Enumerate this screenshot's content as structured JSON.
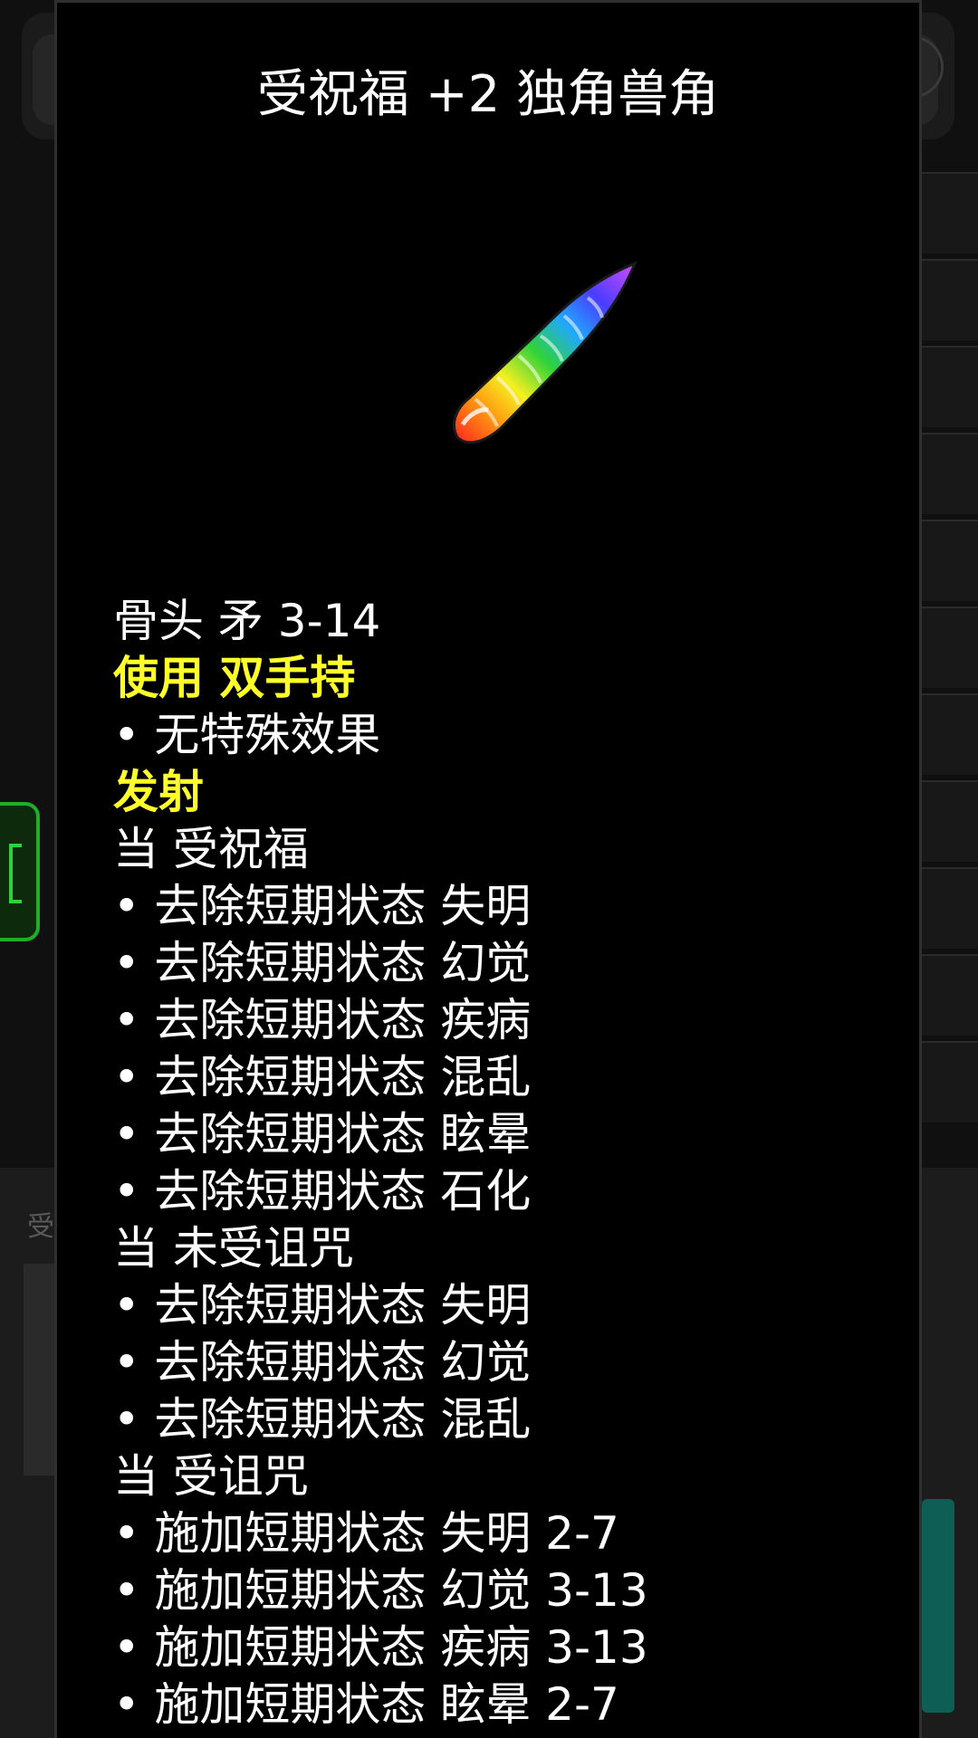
{
  "background": {
    "partial_label": "受"
  },
  "item": {
    "title": "受祝福 +2 独角兽角",
    "image_icon": "unicorn-horn-icon",
    "lines": [
      {
        "text": "骨头 矛 3-14",
        "style": "white"
      },
      {
        "text": "使用 双手持",
        "style": "yellow"
      },
      {
        "text": "无特殊效果",
        "style": "bullet"
      },
      {
        "text": "发射",
        "style": "yellow"
      },
      {
        "text": "当 受祝福",
        "style": "white"
      },
      {
        "text": "去除短期状态 失明",
        "style": "bullet"
      },
      {
        "text": "去除短期状态 幻觉",
        "style": "bullet"
      },
      {
        "text": "去除短期状态 疾病",
        "style": "bullet"
      },
      {
        "text": "去除短期状态 混乱",
        "style": "bullet"
      },
      {
        "text": "去除短期状态 眩晕",
        "style": "bullet"
      },
      {
        "text": "去除短期状态 石化",
        "style": "bullet"
      },
      {
        "text": "当 未受诅咒",
        "style": "white"
      },
      {
        "text": "去除短期状态 失明",
        "style": "bullet"
      },
      {
        "text": "去除短期状态 幻觉",
        "style": "bullet"
      },
      {
        "text": "去除短期状态 混乱",
        "style": "bullet"
      },
      {
        "text": "当 受诅咒",
        "style": "white"
      },
      {
        "text": "施加短期状态 失明 2-7",
        "style": "bullet"
      },
      {
        "text": "施加短期状态 幻觉 3-13",
        "style": "bullet"
      },
      {
        "text": "施加短期状态 疾病 3-13",
        "style": "bullet"
      },
      {
        "text": "施加短期状态 眩晕 2-7",
        "style": "bullet"
      }
    ]
  },
  "colors": {
    "accent_yellow": "#ffff2a",
    "text_white": "#ffffff",
    "dialog_bg": "#000000",
    "bracket_green": "#1fae2a",
    "teal": "#0f5e56"
  }
}
